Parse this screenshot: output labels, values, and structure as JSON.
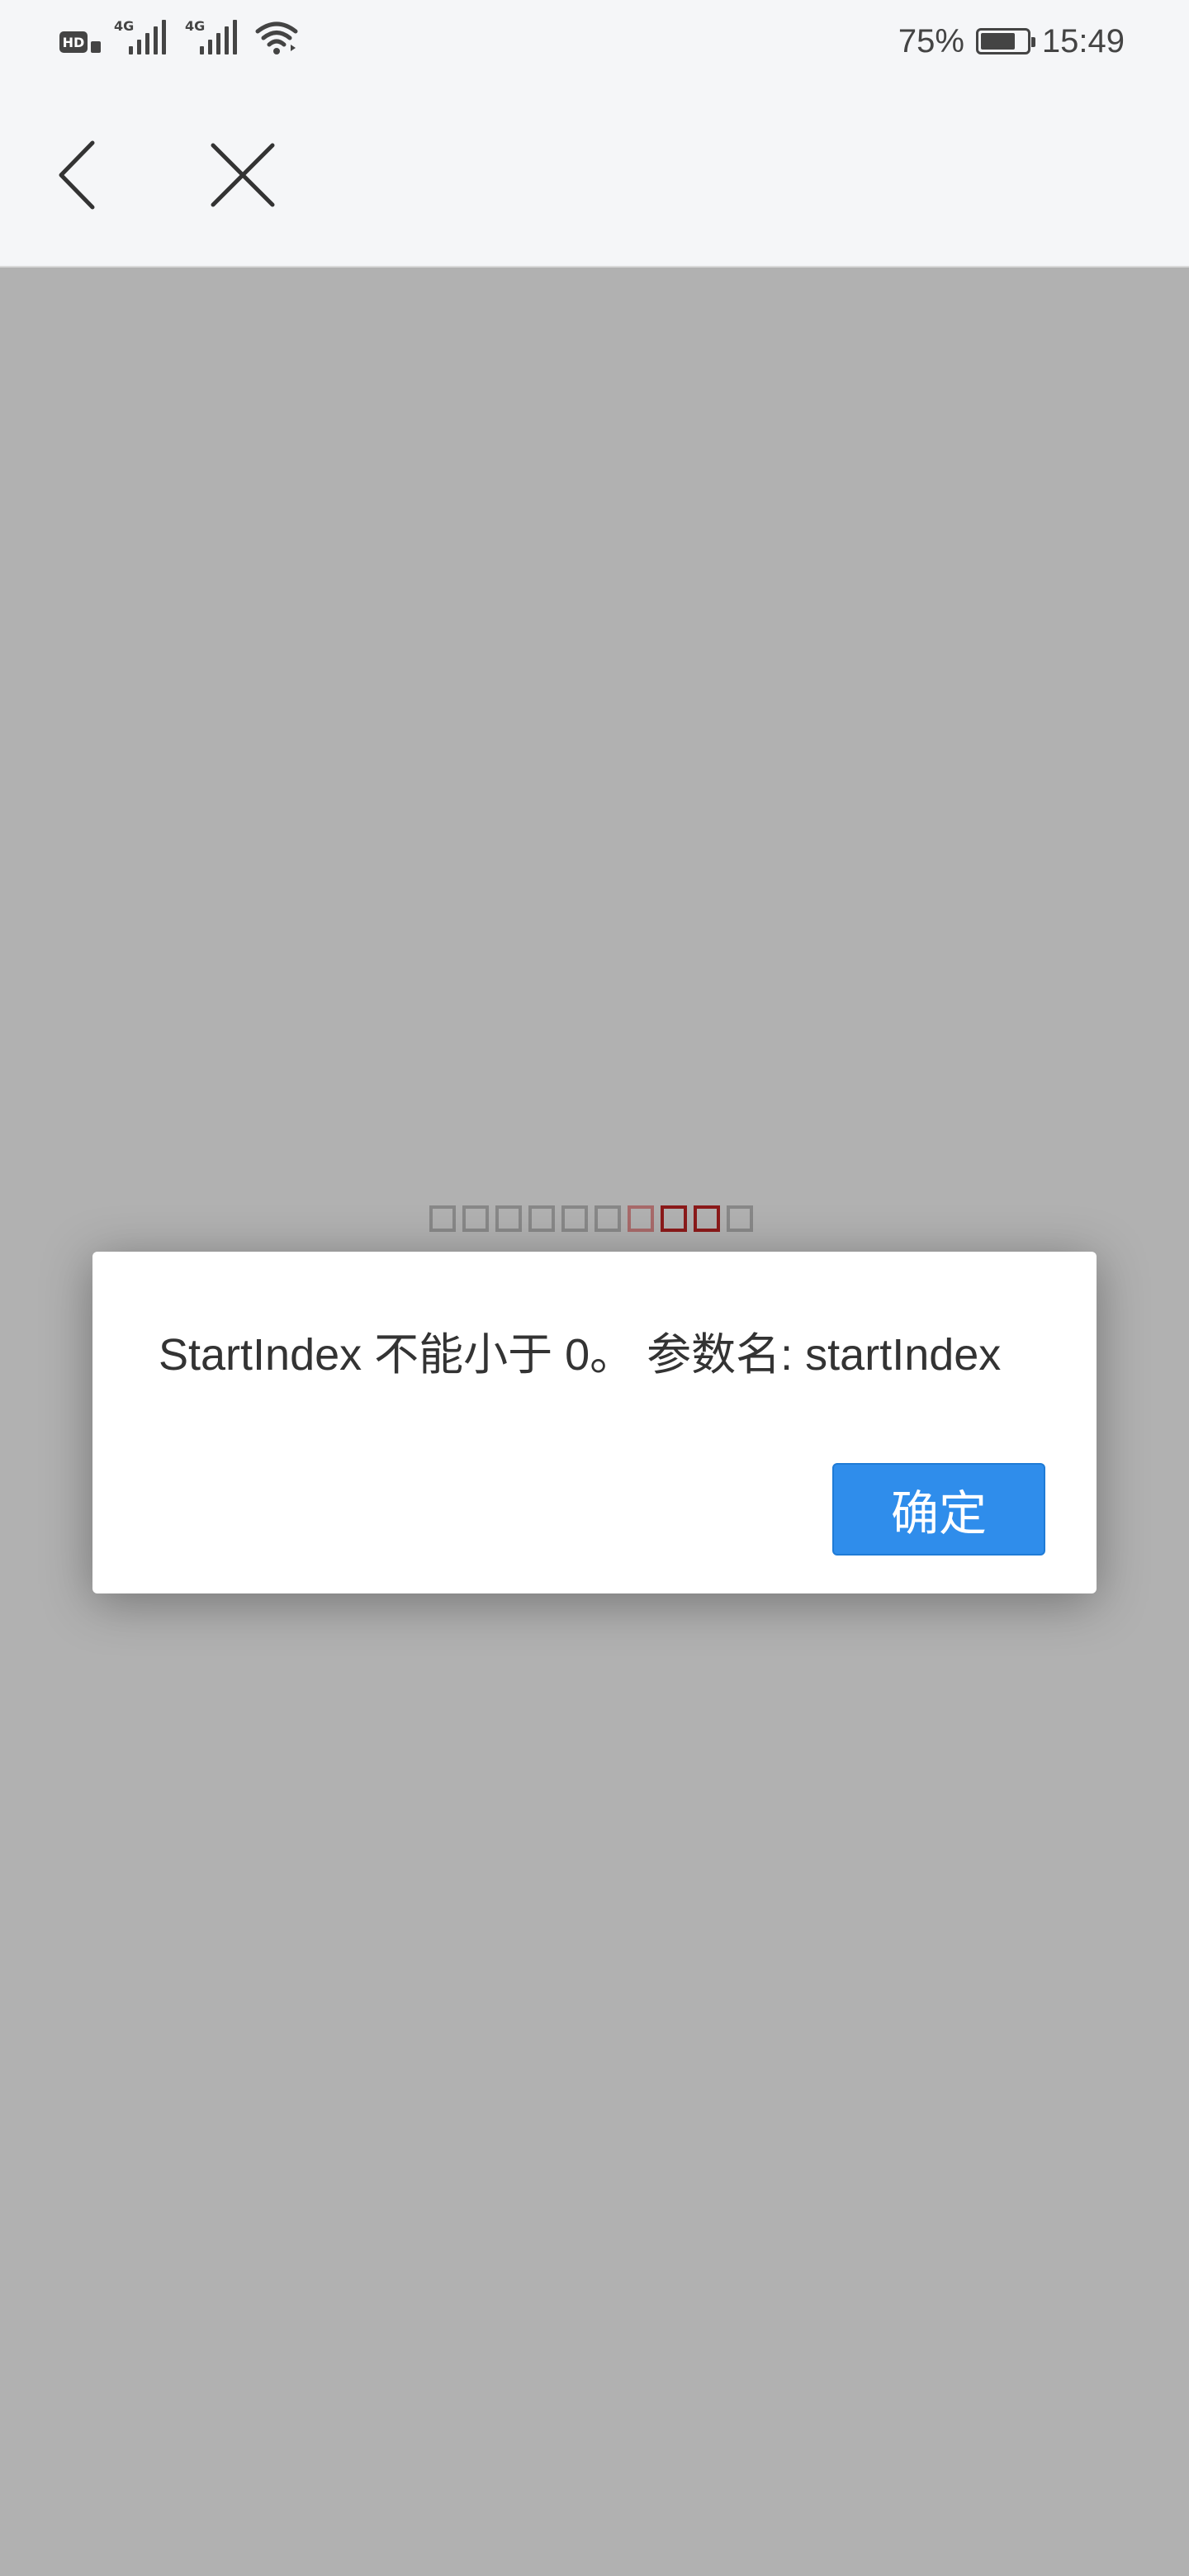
{
  "status_bar": {
    "hd_label": "HD",
    "network_labels": [
      "4G",
      "4G"
    ],
    "battery_percent": "75%",
    "battery_level": 0.75,
    "time": "15:49"
  },
  "nav": {
    "back_icon": "chevron-left-icon",
    "close_icon": "close-icon"
  },
  "loader": {
    "count": 10,
    "active_indices": [
      6,
      7,
      8
    ],
    "colors": {
      "inactive": "#888888",
      "active": "#8b1a1a",
      "active_light": "#a86a6a"
    }
  },
  "dialog": {
    "message": "StartIndex 不能小于 0。 参数名: startIndex",
    "ok_label": "确定",
    "ok_color": "#2f8deb"
  }
}
